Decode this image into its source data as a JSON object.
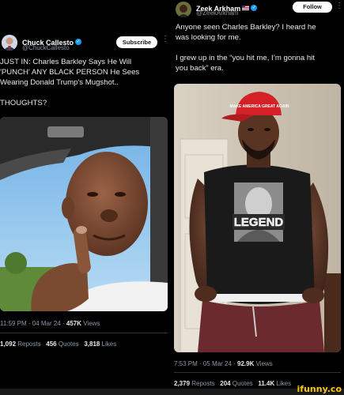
{
  "left_post": {
    "author_name": "Chuck Callesto",
    "author_handle": "@ChuckCallesto",
    "subscribe_label": "Subscribe",
    "text_line1": "JUST IN: Charles Barkley Says He Will",
    "text_line2": "'PUNCH' ANY BLACK PERSON He Sees",
    "text_line3": "Wearing Donald Trump's Mugshot..",
    "text_line4": "THOUGHTS?",
    "time": "11:59 PM · 04 Mar 24 · ",
    "views_count": "457K",
    "views_label": " Views",
    "reposts_count": "1,092",
    "reposts_label": " Reposts",
    "quotes_count": "456",
    "quotes_label": " Quotes",
    "likes_count": "3,818",
    "likes_label": " Likes"
  },
  "right_post": {
    "author_name": "Zeek Arkham",
    "author_handle": "@ZeekArkham",
    "follow_label": "Follow",
    "text_line1": "Anyone seen Charles Barkley? I heard he",
    "text_line2": "was looking for me.",
    "text_line3": "I grew up in the “you hit me, I’m gonna hit",
    "text_line4": "you back” era.",
    "hat_text": "MAKE AMERICA GREAT AGAIN",
    "shirt_text": "LEGEND",
    "time": "7:53 PM · 05 Mar 24 · ",
    "views_count": "92.9K",
    "views_label": " Views",
    "reposts_count": "2,379",
    "reposts_label": " Reposts",
    "quotes_count": "204",
    "quotes_label": " Quotes",
    "likes_count": "11.4K",
    "likes_label": " Likes"
  },
  "watermark": "ifunny.co",
  "icons": {
    "verified": "verified-badge-icon",
    "more": "more-options-icon",
    "flag": "us-flag-icon"
  },
  "colors": {
    "background": "#000000",
    "verified": "#1d9bf0",
    "muted": "#8b98a5",
    "watermark": "#f5c518"
  }
}
